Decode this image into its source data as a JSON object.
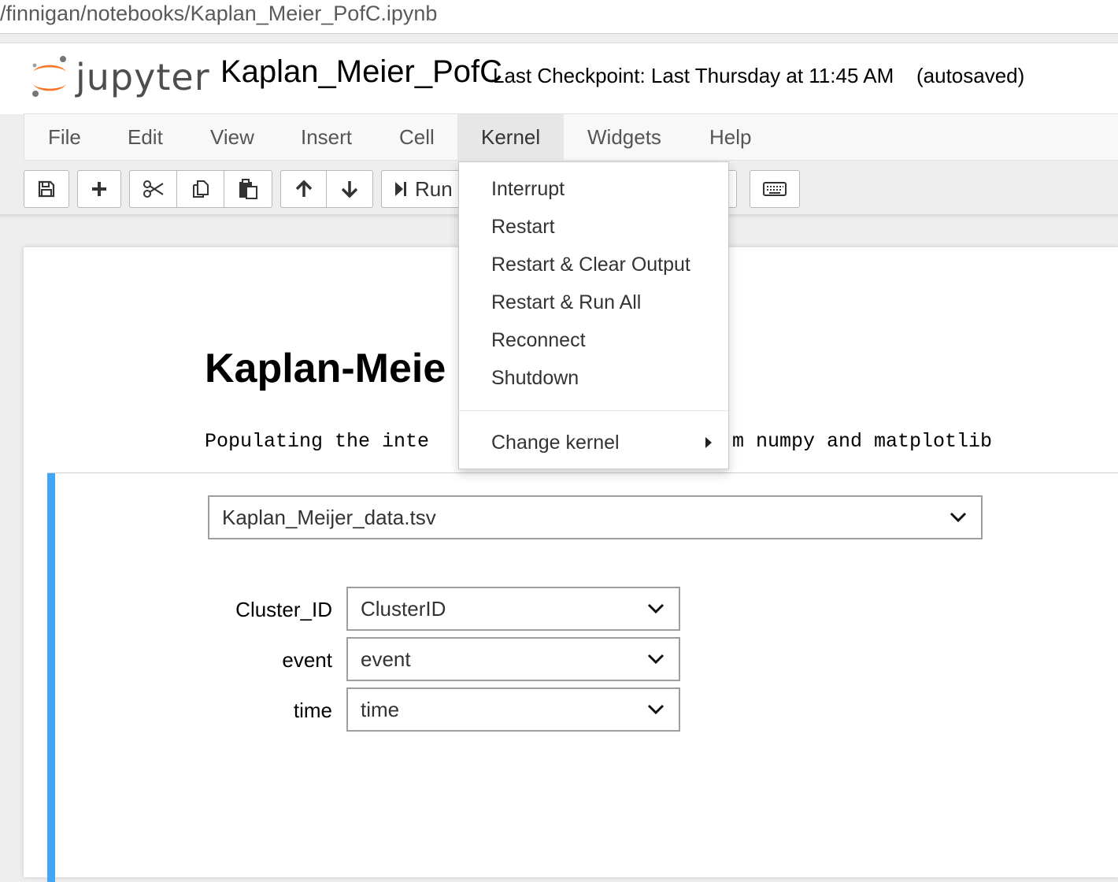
{
  "browser": {
    "url": "/finnigan/notebooks/Kaplan_Meier_PofC.ipynb"
  },
  "header": {
    "logo_text": "jupyter",
    "notebook_title": "Kaplan_Meier_PofC",
    "checkpoint": "Last Checkpoint: Last Thursday at 11:45 AM",
    "autosave_status": "(autosaved)"
  },
  "menubar": {
    "items": [
      "File",
      "Edit",
      "View",
      "Insert",
      "Cell",
      "Kernel",
      "Widgets",
      "Help"
    ],
    "active": "Kernel"
  },
  "toolbar": {
    "run_label": "Run",
    "icons": [
      "save-icon",
      "plus-icon",
      "scissors-icon",
      "copy-icon",
      "paste-icon",
      "arrow-up-icon",
      "arrow-down-icon",
      "step-forward-icon",
      "keyboard-icon"
    ]
  },
  "kernel_menu": {
    "items": [
      "Interrupt",
      "Restart",
      "Restart & Clear Output",
      "Restart & Run All",
      "Reconnect",
      "Shutdown"
    ],
    "submenu_label": "Change kernel"
  },
  "notebook": {
    "heading_visible": "Kaplan-Meie",
    "output_left": "Populating the inte",
    "output_right": "m numpy and matplotlib"
  },
  "widgets": {
    "file_select": "Kaplan_Meijer_data.tsv",
    "fields": [
      {
        "label": "Cluster_ID",
        "value": "ClusterID"
      },
      {
        "label": "event",
        "value": "event"
      },
      {
        "label": "time",
        "value": "time"
      }
    ]
  },
  "colors": {
    "cell_selected_bar": "#42a5f5",
    "jupyter_orange": "#f37726"
  }
}
